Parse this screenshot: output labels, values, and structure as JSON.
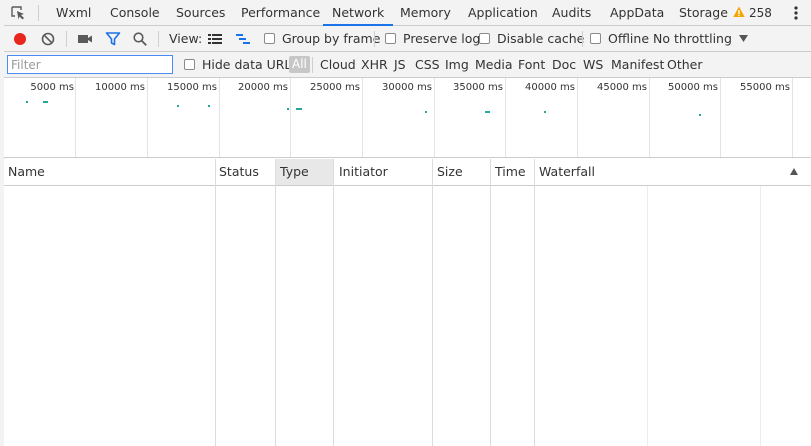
{
  "tabs": [
    "Wxml",
    "Console",
    "Sources",
    "Performance",
    "Network",
    "Memory",
    "Application",
    "Audits",
    "AppData",
    "Storage"
  ],
  "active_tab": "Network",
  "warning_count": "258",
  "toolbar": {
    "view_label": "View:",
    "group_by_frame": "Group by frame",
    "preserve_log": "Preserve log",
    "disable_cache": "Disable cache",
    "offline": "Offline",
    "throttling": "No throttling"
  },
  "filter": {
    "placeholder": "Filter",
    "value": "",
    "hide_data_urls": "Hide data URLs",
    "types": [
      "All",
      "Cloud",
      "XHR",
      "JS",
      "CSS",
      "Img",
      "Media",
      "Font",
      "Doc",
      "WS",
      "Manifest",
      "Other"
    ]
  },
  "overview": {
    "ticks": [
      "5000 ms",
      "10000 ms",
      "15000 ms",
      "20000 ms",
      "25000 ms",
      "30000 ms",
      "35000 ms",
      "40000 ms",
      "45000 ms",
      "50000 ms",
      "55000 ms"
    ]
  },
  "table": {
    "columns": [
      "Name",
      "Status",
      "Type",
      "Initiator",
      "Size",
      "Time",
      "Waterfall"
    ],
    "sorted_column": "Type"
  },
  "colors": {
    "accent": "#1a73e8",
    "record": "#e8261c",
    "filter_icon": "#1a73e8",
    "warning": "#f2a600",
    "overview_mark": "#22aa99"
  }
}
